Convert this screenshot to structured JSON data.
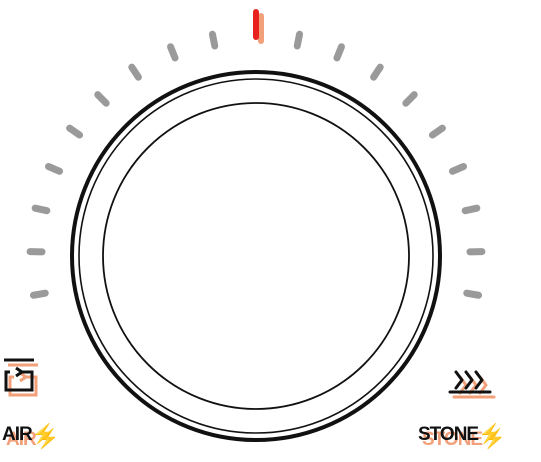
{
  "dial": {
    "tick_count": 19,
    "active_tick_index": 9,
    "colors": {
      "tick": "#9a9a9a",
      "active_tick": "#e8211c",
      "active_tick_shadow": "#f2a07a",
      "knob_stroke": "#111111",
      "knob_fill": "#ffffff"
    }
  },
  "modes": {
    "left": {
      "icon": "fan-circulation-icon",
      "label": "AIR",
      "bolt": "⚡"
    },
    "right": {
      "icon": "stone-heat-icon",
      "label": "STONE",
      "bolt": "⚡"
    }
  }
}
